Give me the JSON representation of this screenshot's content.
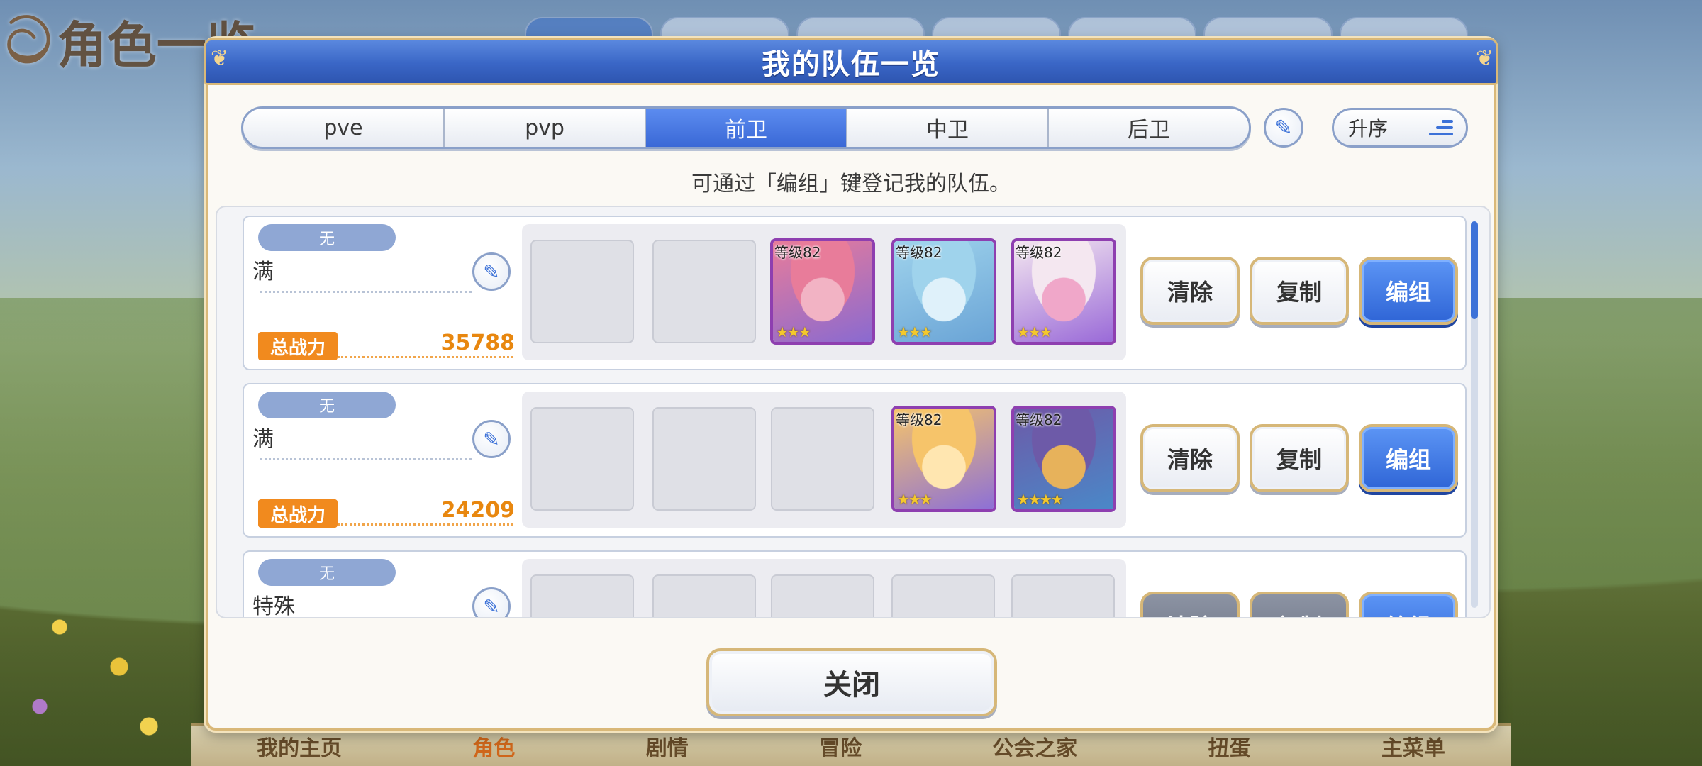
{
  "background": {
    "screen_title": "角色一览",
    "bottom_nav": [
      "我的主页",
      "角色",
      "剧情",
      "冒险",
      "公会之家",
      "扭蛋",
      "主菜单"
    ],
    "active_nav": "角色"
  },
  "modal": {
    "title": "我的队伍一览",
    "tabs": [
      {
        "label": "pve",
        "active": false
      },
      {
        "label": "pvp",
        "active": false
      },
      {
        "label": "前卫",
        "active": true
      },
      {
        "label": "中卫",
        "active": false
      },
      {
        "label": "后卫",
        "active": false
      }
    ],
    "sort_label": "升序",
    "hint": "可通过「编组」键登记我的队伍。",
    "close_label": "关闭"
  },
  "teams": [
    {
      "badge": "无",
      "name": "满",
      "power_label": "总战力",
      "power": "35788",
      "members": [
        null,
        null,
        {
          "level": "等级82",
          "stars": "★★★",
          "colors": [
            "#e87c9a",
            "#f2b3c4",
            "#8a6ad0"
          ]
        },
        {
          "level": "等级82",
          "stars": "★★★",
          "colors": [
            "#9fd3ec",
            "#dff1fa",
            "#6aa4d6"
          ]
        },
        {
          "level": "等级82",
          "stars": "★★★",
          "colors": [
            "#f4e7f0",
            "#f0a7c9",
            "#9a6ad8"
          ]
        }
      ],
      "actions": [
        "清除",
        "复制",
        "编组"
      ]
    },
    {
      "badge": "无",
      "name": "满",
      "power_label": "总战力",
      "power": "24209",
      "members": [
        null,
        null,
        null,
        {
          "level": "等级82",
          "stars": "★★★",
          "colors": [
            "#f6c46a",
            "#ffe6b0",
            "#8d70d6"
          ]
        },
        {
          "level": "等级82",
          "stars": "★★★★",
          "colors": [
            "#6d5aa8",
            "#e7b25b",
            "#4a88c8"
          ]
        }
      ],
      "actions": [
        "清除",
        "复制",
        "编组"
      ]
    },
    {
      "badge": "无",
      "name": "特殊",
      "power_label": "",
      "power": "",
      "members": [
        null,
        null,
        null,
        null,
        null
      ],
      "actions": [
        "清除",
        "复制",
        "编组"
      ]
    }
  ]
}
